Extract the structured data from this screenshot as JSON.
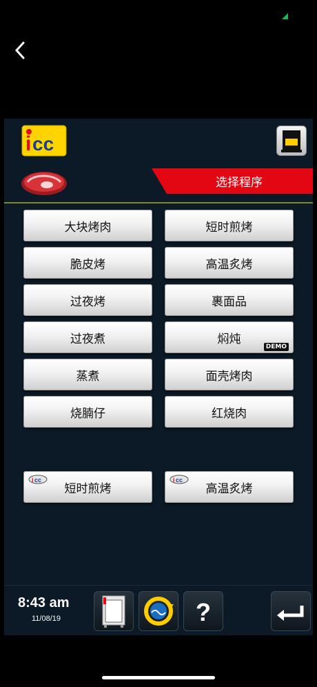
{
  "header": {
    "title": "选择程序"
  },
  "programs": [
    {
      "label": "大块烤肉"
    },
    {
      "label": "短时煎烤"
    },
    {
      "label": "脆皮烤"
    },
    {
      "label": "高温炙烤"
    },
    {
      "label": "过夜烤"
    },
    {
      "label": "裹面品"
    },
    {
      "label": "过夜煮"
    },
    {
      "label": "焖炖",
      "badge": "DEMO"
    },
    {
      "label": "蒸煮"
    },
    {
      "label": "面壳烤肉"
    },
    {
      "label": "烧腩仔"
    },
    {
      "label": "红烧肉"
    }
  ],
  "favorites": [
    {
      "label": "短时煎烤"
    },
    {
      "label": "高温炙烤"
    }
  ],
  "status": {
    "time": "8:43 am",
    "date": "11/08/19"
  },
  "colors": {
    "accent": "#e30613",
    "panel": "#0b1a26",
    "divider": "#7d8a33"
  },
  "icons": [
    "back-icon",
    "icc-logo-icon",
    "cup-icon",
    "meat-icon",
    "oven-icon",
    "cleaning-icon",
    "help-icon",
    "return-icon"
  ]
}
